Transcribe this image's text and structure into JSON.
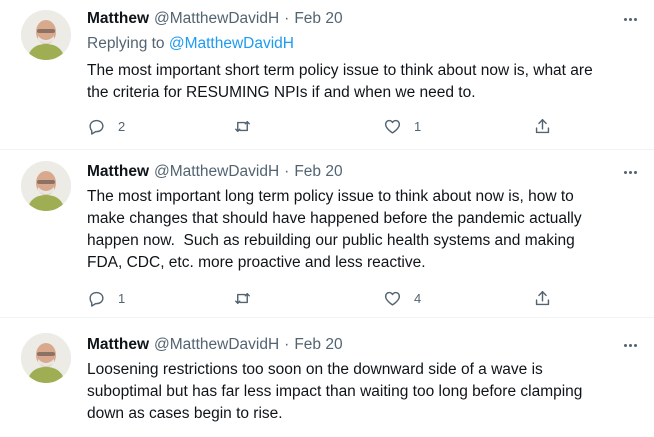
{
  "colors": {
    "text": "#0f1419",
    "muted": "#536471",
    "link": "#1d9bf0",
    "divider": "#eff3f4"
  },
  "tweets": [
    {
      "name": "Matthew",
      "handle": "@MatthewDavidH",
      "separator": "·",
      "date": "Feb 20",
      "replying_prefix": "Replying to ",
      "replying_to": "@MatthewDavidH",
      "text": "The most important short term policy issue to think about now is, what are\nthe criteria for RESUMING NPIs if and when we need to.",
      "replies": "2",
      "retweets": "",
      "likes": "1",
      "icons": {
        "more": "more-dots-icon",
        "reply": "reply-icon",
        "retweet": "retweet-icon",
        "like": "heart-icon",
        "share": "share-icon"
      }
    },
    {
      "name": "Matthew",
      "handle": "@MatthewDavidH",
      "separator": "·",
      "date": "Feb 20",
      "text": "The most important long term policy issue to think about now is, how to\nmake changes that should have happened before the pandemic actually\nhappen now.  Such as rebuilding our public health systems and making\nFDA, CDC, etc. more proactive and less reactive.",
      "replies": "1",
      "retweets": "",
      "likes": "4",
      "icons": {
        "more": "more-dots-icon",
        "reply": "reply-icon",
        "retweet": "retweet-icon",
        "like": "heart-icon",
        "share": "share-icon"
      }
    },
    {
      "name": "Matthew",
      "handle": "@MatthewDavidH",
      "separator": "·",
      "date": "Feb 20",
      "text": "Loosening restrictions too soon on the downward side of a wave is\nsuboptimal but has far less impact than waiting too long before clamping\ndown as cases begin to rise.",
      "icons": {
        "more": "more-dots-icon"
      }
    }
  ]
}
